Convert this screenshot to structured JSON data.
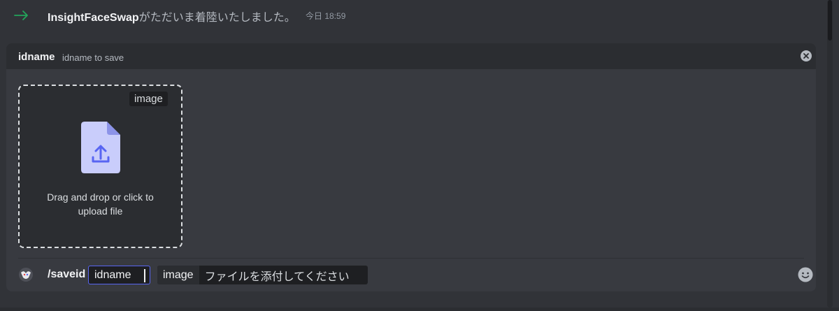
{
  "system_message": {
    "username": "InsightFaceSwap",
    "text": "がただいま着陸いたしました。",
    "timestamp": "今日 18:59",
    "icon": "join-arrow-icon",
    "accent_color": "#23a55a"
  },
  "option_header": {
    "name": "idname",
    "description": "idname to save",
    "close_icon": "close-icon"
  },
  "upload": {
    "tag": "image",
    "text_line1": "Drag and drop or click to",
    "text_line2": "upload file",
    "icon": "file-upload-icon"
  },
  "command": {
    "name": "/saveid",
    "active_option": {
      "label": "idname",
      "value": ""
    },
    "pending_option": {
      "label": "image",
      "placeholder": "ファイルを添付してください"
    },
    "bot_avatar": "bot-avatar-icon",
    "emoji_icon": "emoji-smile-icon"
  },
  "colors": {
    "background": "#313338",
    "composer": "#383a40",
    "header": "#2b2d31",
    "focus": "#5865f2",
    "upload_icon": "#c9cdfb"
  }
}
